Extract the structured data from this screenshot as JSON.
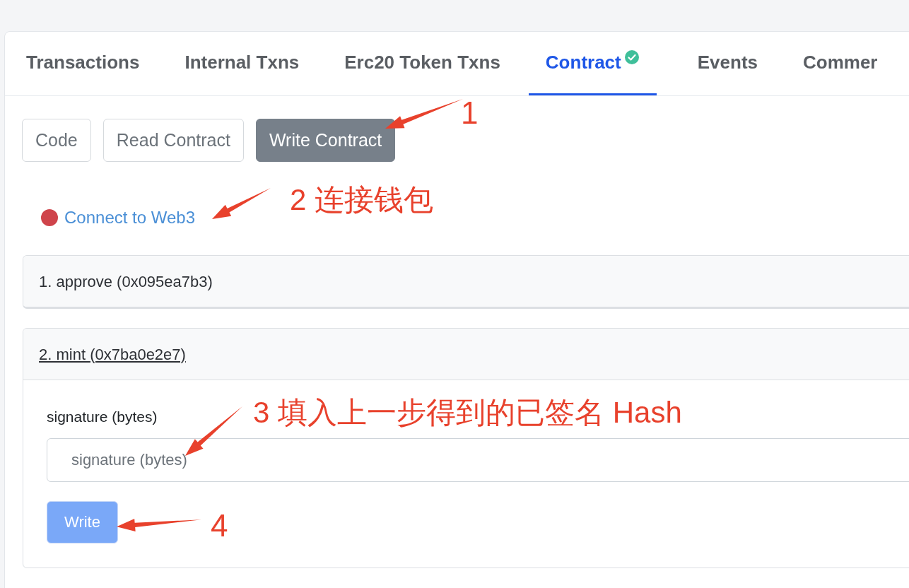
{
  "tabs": [
    {
      "label": "Transactions",
      "selected": false,
      "verified": false
    },
    {
      "label": "Internal Txns",
      "selected": false,
      "verified": false
    },
    {
      "label": "Erc20 Token Txns",
      "selected": false,
      "verified": false
    },
    {
      "label": "Contract",
      "selected": true,
      "verified": true
    },
    {
      "label": "Events",
      "selected": false,
      "verified": false
    },
    {
      "label": "Commer",
      "selected": false,
      "verified": false
    }
  ],
  "subtabs": [
    {
      "label": "Code",
      "selected": false
    },
    {
      "label": "Read Contract",
      "selected": false
    },
    {
      "label": "Write Contract",
      "selected": true
    }
  ],
  "connect": {
    "label": "Connect to Web3",
    "connected": false
  },
  "methods": [
    {
      "title": "1. approve (0x095ea7b3)",
      "expanded": false
    },
    {
      "title": "2. mint (0x7ba0e2e7)",
      "expanded": true,
      "inputs": [
        {
          "label": "signature (bytes)",
          "placeholder": "signature (bytes)"
        }
      ],
      "button": "Write"
    }
  ],
  "annotations": [
    {
      "label": "1"
    },
    {
      "label": "2 连接钱包"
    },
    {
      "label": "3 填入上一步得到的已签名 Hash"
    },
    {
      "label": "4"
    }
  ]
}
